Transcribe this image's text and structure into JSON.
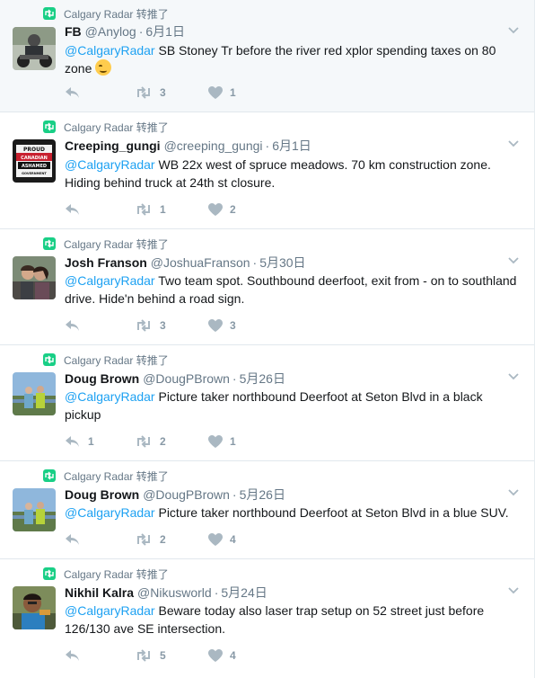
{
  "tweets": [
    {
      "retweeted_by": "Calgary Radar 转推了",
      "name": "FB",
      "handle": "@Anylog",
      "time": "6月1日",
      "mention": "@CalgaryRadar",
      "text": " SB Stoney Tr before the river red xplor spending taxes on 80 zone",
      "emoji": "smirking-face",
      "retweets": "3",
      "likes": "1",
      "replies": ""
    },
    {
      "retweeted_by": "Calgary Radar 转推了",
      "name": "Creeping_gungi",
      "handle": "@creeping_gungi",
      "time": "6月1日",
      "mention": "@CalgaryRadar",
      "text": " WB 22x west of spruce meadows. 70 km construction zone. Hiding behind truck at 24th st closure.",
      "avatar_text": [
        "PROUD",
        "CANADIAN",
        "ASHAMED",
        "GOVERNMENT"
      ],
      "retweets": "1",
      "likes": "2",
      "replies": ""
    },
    {
      "retweeted_by": "Calgary Radar 转推了",
      "name": "Josh Franson",
      "handle": "@JoshuaFranson",
      "time": "5月30日",
      "mention": "@CalgaryRadar",
      "text": " Two team spot. Southbound deerfoot, exit from - on to southland drive. Hide'n behind a road sign.",
      "retweets": "3",
      "likes": "3",
      "replies": ""
    },
    {
      "retweeted_by": "Calgary Radar 转推了",
      "name": "Doug Brown",
      "handle": "@DougPBrown",
      "time": "5月26日",
      "mention": "@CalgaryRadar",
      "text": " Picture taker northbound Deerfoot at Seton Blvd in a black pickup",
      "replies": "1",
      "retweets": "2",
      "likes": "1"
    },
    {
      "retweeted_by": "Calgary Radar 转推了",
      "name": "Doug Brown",
      "handle": "@DougPBrown",
      "time": "5月26日",
      "mention": "@CalgaryRadar",
      "text": " Picture taker northbound Deerfoot at Seton Blvd in a blue SUV.",
      "replies": "",
      "retweets": "2",
      "likes": "4"
    },
    {
      "retweeted_by": "Calgary Radar 转推了",
      "name": "Nikhil Kalra",
      "handle": "@Nikusworld",
      "time": "5月24日",
      "mention": "@CalgaryRadar",
      "text": " Beware today also laser trap setup on 52 street just before 126/130 ave SE intersection.",
      "replies": "",
      "retweets": "5",
      "likes": "4"
    }
  ],
  "colors": {
    "accent": "#1da1f2",
    "retweet_green": "#19cf86",
    "muted": "#657786",
    "icon": "#aab8c2"
  }
}
